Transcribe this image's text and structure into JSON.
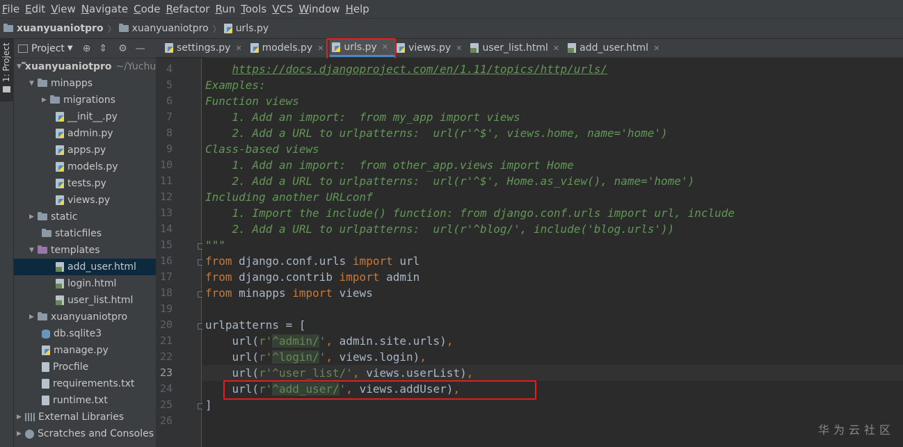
{
  "menu": [
    "File",
    "Edit",
    "View",
    "Navigate",
    "Code",
    "Refactor",
    "Run",
    "Tools",
    "VCS",
    "Window",
    "Help"
  ],
  "breadcrumb": [
    "xuanyuaniotpro",
    "xuanyuaniotpro",
    "urls.py"
  ],
  "toolstrip": {
    "project_label": "1: Project"
  },
  "project_panel": {
    "title": "Project",
    "root": "xuanyuaniotpro",
    "root_path": "~/Yuchu",
    "items": [
      {
        "label": "minapps"
      },
      {
        "label": "migrations"
      },
      {
        "label": "__init__.py"
      },
      {
        "label": "admin.py"
      },
      {
        "label": "apps.py"
      },
      {
        "label": "models.py"
      },
      {
        "label": "tests.py"
      },
      {
        "label": "views.py"
      },
      {
        "label": "static"
      },
      {
        "label": "staticfiles"
      },
      {
        "label": "templates"
      },
      {
        "label": "add_user.html"
      },
      {
        "label": "login.html"
      },
      {
        "label": "user_list.html"
      },
      {
        "label": "xuanyuaniotpro"
      },
      {
        "label": "db.sqlite3"
      },
      {
        "label": "manage.py"
      },
      {
        "label": "Procfile"
      },
      {
        "label": "requirements.txt"
      },
      {
        "label": "runtime.txt"
      },
      {
        "label": "External Libraries"
      },
      {
        "label": "Scratches and Consoles"
      }
    ]
  },
  "tabs": [
    {
      "label": "settings.py"
    },
    {
      "label": "models.py"
    },
    {
      "label": "urls.py"
    },
    {
      "label": "views.py"
    },
    {
      "label": "user_list.html"
    },
    {
      "label": "add_user.html"
    }
  ],
  "line_numbers": [
    "4",
    "5",
    "6",
    "7",
    "8",
    "9",
    "10",
    "11",
    "12",
    "13",
    "14",
    "15",
    "16",
    "17",
    "18",
    "19",
    "20",
    "21",
    "22",
    "23",
    "24",
    "25",
    "26"
  ],
  "code": {
    "l4": "https://docs.djangoproject.com/en/1.11/topics/http/urls/",
    "l5": "Examples:",
    "l6": "Function views",
    "l7": "    1. Add an import:  from my_app import views",
    "l8": "    2. Add a URL to urlpatterns:  url(r'^$', views.home, name='home')",
    "l9": "Class-based views",
    "l10": "    1. Add an import:  from other_app.views import Home",
    "l11": "    2. Add a URL to urlpatterns:  url(r'^$', Home.as_view(), name='home')",
    "l12": "Including another URLconf",
    "l13": "    1. Import the include() function: from django.conf.urls import url, include",
    "l14": "    2. Add a URL to urlpatterns:  url(r'^blog/', include('blog.urls'))",
    "l15": "\"\"\"",
    "kw_from": "from",
    "kw_import": "import",
    "l16_mod": " django.conf.urls ",
    "l16_name": " url",
    "l17_mod": " django.contrib ",
    "l17_name": " admin",
    "l18_mod": " minapps ",
    "l18_name": " views",
    "l20": "urlpatterns = [",
    "url_open": "    url(",
    "r_prefix": "r'",
    "quote": "'",
    "comma": ",",
    "l21_rx": "^admin/",
    "l21_rest": " admin.site.urls)",
    "l22_rx": "^login/",
    "l22_rest": " views.login)",
    "l23_rx": "^user_list/",
    "l23_rest": " views.userList)",
    "l24_rx": "^add_user/",
    "l24_rest": " views.addUser)",
    "l25": "]"
  },
  "watermark": "华为云社区",
  "colors": {
    "editor_bg": "#2b2b2b",
    "docstring": "#629755",
    "keyword": "#cc7832",
    "string": "#6a8759",
    "highlight_box": "#e02020"
  }
}
